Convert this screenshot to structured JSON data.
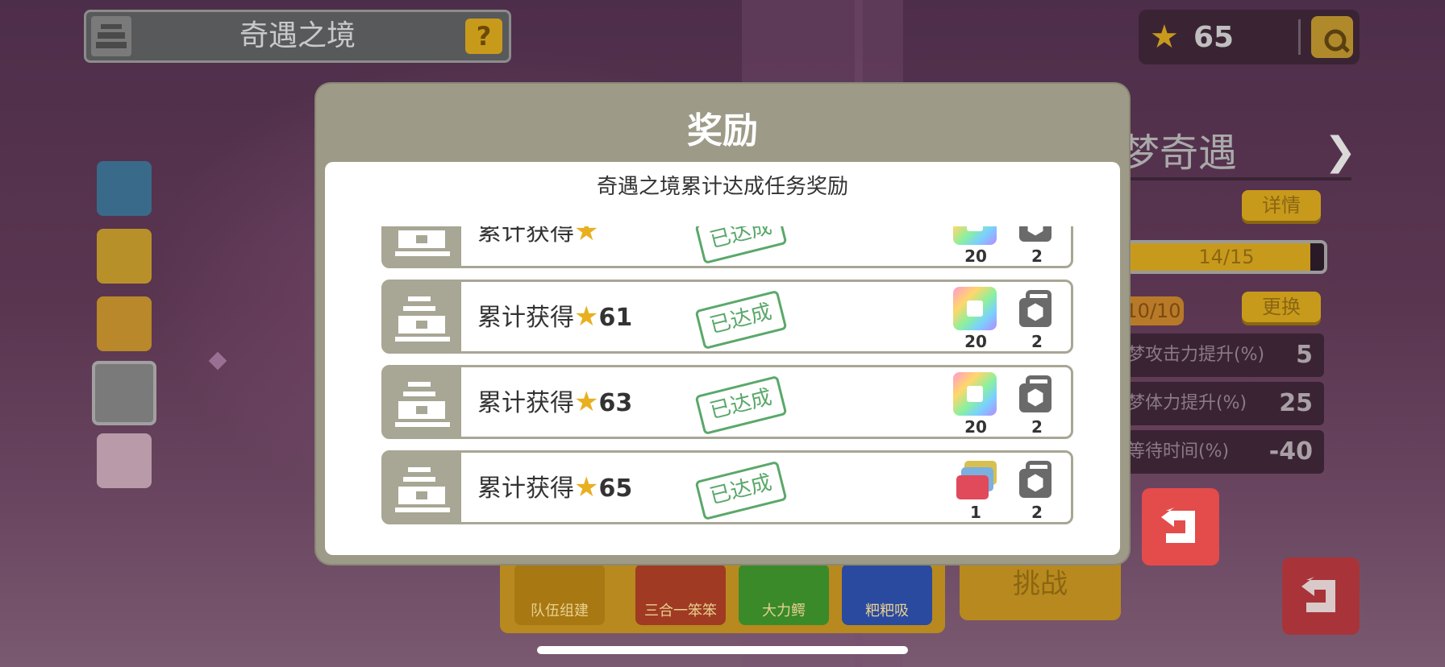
{
  "header": {
    "area_title": "奇遇之境",
    "help_label": "?"
  },
  "currency": {
    "amount": "65"
  },
  "right_panel": {
    "title": "梦奇遇",
    "details_label": "详情",
    "progress_label": "14/15",
    "progress_value": 0.93,
    "slot_count": "10/10",
    "swap_label": "更换",
    "stats": [
      {
        "label": "梦攻击力提升(%)",
        "value": "5"
      },
      {
        "label": "梦体力提升(%)",
        "value": "25"
      },
      {
        "label": "等待时间(%)",
        "value": "-40"
      }
    ]
  },
  "team_bar": {
    "slots": [
      {
        "label": "队伍组建",
        "color": "#b8891e"
      },
      {
        "label": "三合一笨笨",
        "color": "#a03a22"
      },
      {
        "label": "大力鳄",
        "color": "#3a8a2a"
      },
      {
        "label": "粑粑吸",
        "color": "#2a4aa0"
      }
    ],
    "challenge_label": "挑战"
  },
  "modal": {
    "title": "奖励",
    "subtitle": "奇遇之境累计达成任务奖励",
    "rows": [
      {
        "prefix": "累计获得",
        "star_count": "",
        "status": "已达成",
        "rewards": [
          {
            "icon": "rainbow-cube-icon",
            "count": "20"
          },
          {
            "icon": "bag-icon",
            "count": "2"
          }
        ]
      },
      {
        "prefix": "累计获得",
        "star_count": "61",
        "status": "已达成",
        "rewards": [
          {
            "icon": "rainbow-cube-icon",
            "count": "20"
          },
          {
            "icon": "bag-icon",
            "count": "2"
          }
        ]
      },
      {
        "prefix": "累计获得",
        "star_count": "63",
        "status": "已达成",
        "rewards": [
          {
            "icon": "rainbow-cube-icon",
            "count": "20"
          },
          {
            "icon": "bag-icon",
            "count": "2"
          }
        ]
      },
      {
        "prefix": "累计获得",
        "star_count": "65",
        "status": "已达成",
        "rewards": [
          {
            "icon": "card-stack-icon",
            "count": "1"
          },
          {
            "icon": "bag-icon",
            "count": "2"
          }
        ]
      }
    ]
  }
}
